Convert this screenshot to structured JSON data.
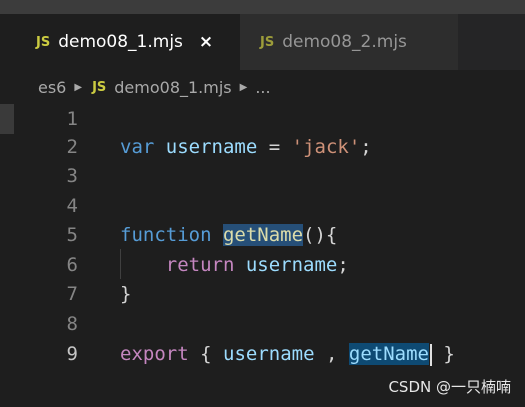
{
  "tabs": [
    {
      "icon": "JS",
      "label": "demo08_1.mjs",
      "close": "×"
    },
    {
      "icon": "JS",
      "label": "demo08_2.mjs"
    }
  ],
  "breadcrumbs": {
    "folder": "es6",
    "file_icon": "JS",
    "file": "demo08_1.mjs",
    "ellipsis": "..."
  },
  "lines": [
    {
      "num": "1"
    },
    {
      "num": "2",
      "tokens": [
        "var",
        "username",
        "=",
        "'jack'",
        ";"
      ]
    },
    {
      "num": "3"
    },
    {
      "num": "4"
    },
    {
      "num": "5",
      "tokens": [
        "function",
        "getName",
        "(){"
      ]
    },
    {
      "num": "6",
      "tokens": [
        "return",
        "username",
        ";"
      ]
    },
    {
      "num": "7",
      "tokens": [
        "}"
      ]
    },
    {
      "num": "8"
    },
    {
      "num": "9",
      "tokens": [
        "export",
        "{",
        "username",
        ",",
        "getName",
        "}"
      ]
    }
  ],
  "watermark": "CSDN @一只楠喃",
  "colors": {
    "background": "#1e1e1e",
    "keyword": "#569cd6",
    "export_keyword": "#c586c0",
    "variable": "#9cdcfe",
    "string": "#ce9178",
    "function": "#dcdcaa",
    "highlight": "#264f78"
  }
}
